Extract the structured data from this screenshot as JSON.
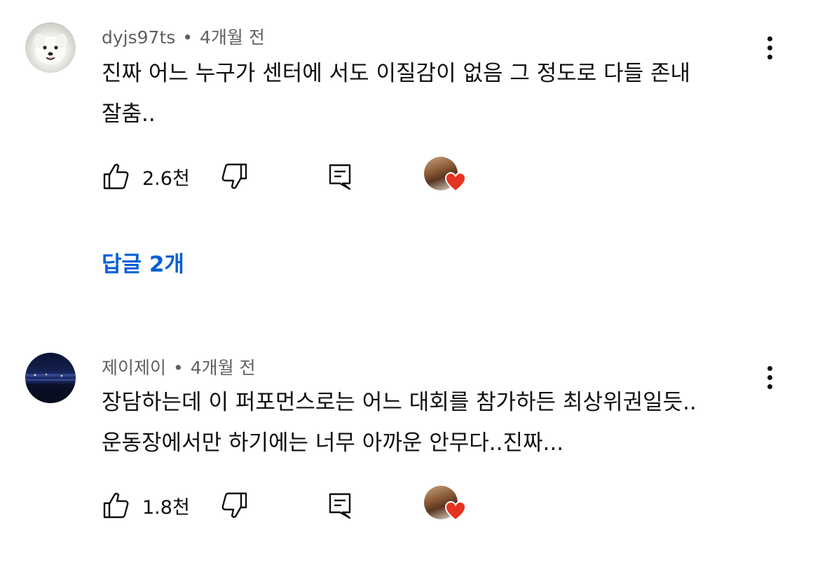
{
  "comments": [
    {
      "author": "dyjs97ts",
      "separator": "•",
      "time": "4개월 전",
      "text_lines": [
        "진짜 어느 누구가 센터에 서도 이질감이 없음 그 정도로 다들 존내",
        "잘춤.."
      ],
      "likes": "2.6천",
      "replies_label": "답글 2개"
    },
    {
      "author": "제이제이",
      "separator": "•",
      "time": "4개월 전",
      "text_lines": [
        "장담하는데 이 퍼포먼스로는 어느 대회를 참가하든 최상위권일듯..",
        "운동장에서만 하기에는 너무 아까운 안무다..진짜..."
      ],
      "likes": "1.8천"
    }
  ],
  "icons": {
    "like": "thumbs-up-icon",
    "dislike": "thumbs-down-icon",
    "reply": "comment-reply-icon",
    "more": "more-vertical-icon",
    "creator_heart": "heart-icon"
  },
  "colors": {
    "link_blue": "#065fd4",
    "heart_red": "#e6331f",
    "meta_gray": "#606060"
  }
}
